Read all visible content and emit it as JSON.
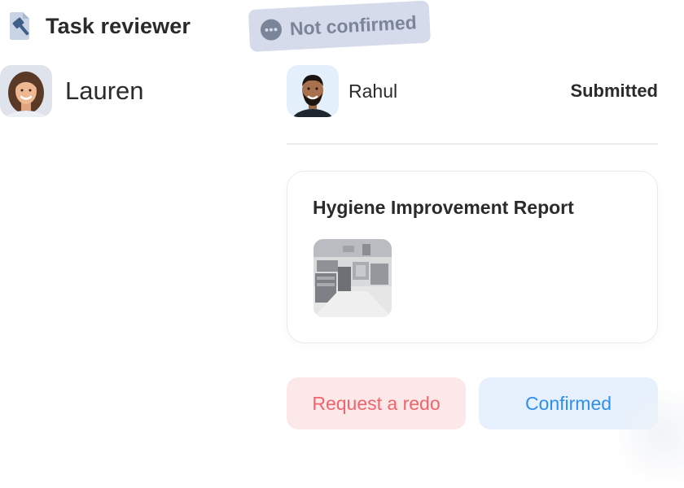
{
  "header": {
    "title": "Task reviewer",
    "icon": "hammer-icon"
  },
  "status_pill": {
    "label": "Not confirmed",
    "icon": "more-dots-icon",
    "color_bg": "#d5dbea",
    "color_text": "#7a8599"
  },
  "reviewer": {
    "name": "Lauren",
    "avatar": "reviewer-avatar"
  },
  "submission": {
    "submitter_name": "Rahul",
    "avatar": "submitter-avatar",
    "status": "Submitted"
  },
  "report": {
    "title": "Hygiene Improvement Report",
    "attachment": "kitchen-photo"
  },
  "actions": {
    "redo_label": "Request a redo",
    "confirm_label": "Confirmed",
    "redo_color": "#f1646c",
    "confirm_color": "#2f8ff0"
  }
}
